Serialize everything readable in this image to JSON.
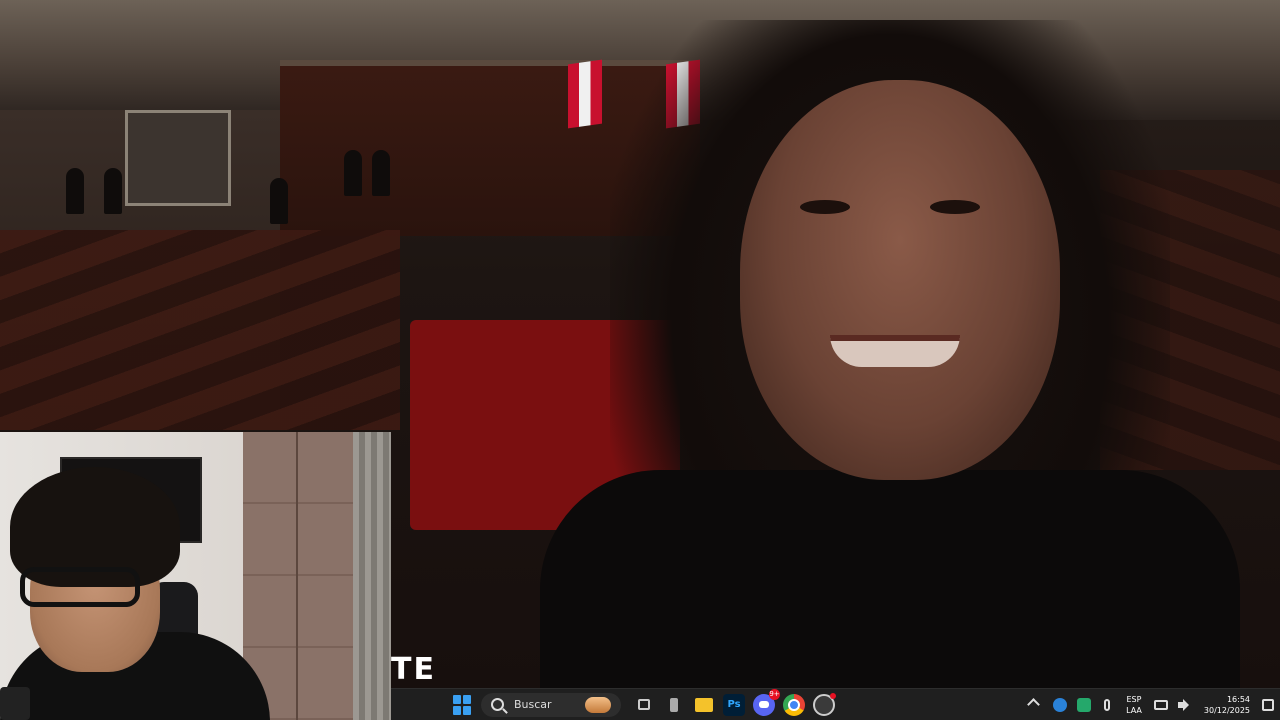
{
  "video": {
    "overlay_text": "TE"
  },
  "taskbar": {
    "search_placeholder": "Buscar",
    "pinned_apps": [
      {
        "name": "task-view"
      },
      {
        "name": "app"
      },
      {
        "name": "file-explorer"
      },
      {
        "name": "photoshop",
        "label": "Ps"
      },
      {
        "name": "discord",
        "badge": "9+"
      },
      {
        "name": "chrome"
      },
      {
        "name": "obs"
      }
    ],
    "tray": {
      "lang_line1": "ESP",
      "lang_line2": "LAA",
      "time": "16:54",
      "date": "30/12/2025"
    }
  },
  "colors": {
    "taskbar_bg": "#1f1f1f",
    "start_blue": "#3aa0f2",
    "discord_badge": "#e81123"
  }
}
